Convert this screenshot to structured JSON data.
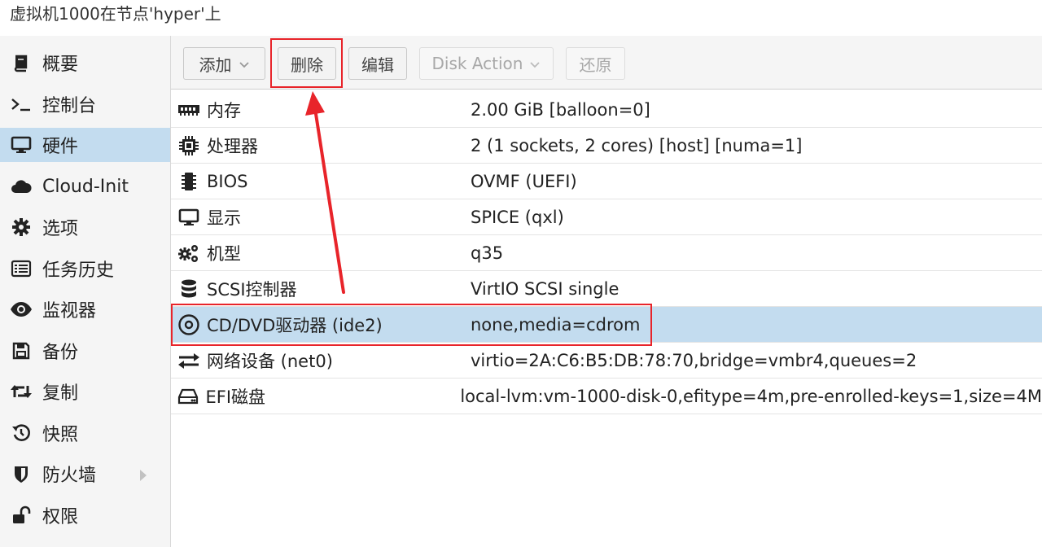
{
  "window": {
    "title": "虚拟机1000在节点'hyper'上"
  },
  "sidebar": {
    "items": [
      {
        "label": "概要",
        "icon": "book-icon"
      },
      {
        "label": "控制台",
        "icon": "terminal-icon"
      },
      {
        "label": "硬件",
        "icon": "desktop-icon",
        "selected": true
      },
      {
        "label": "Cloud-Init",
        "icon": "cloud-icon"
      },
      {
        "label": "选项",
        "icon": "gear-icon"
      },
      {
        "label": "任务历史",
        "icon": "list-icon"
      },
      {
        "label": "监视器",
        "icon": "eye-icon"
      },
      {
        "label": "备份",
        "icon": "floppy-icon"
      },
      {
        "label": "复制",
        "icon": "retweet-icon"
      },
      {
        "label": "快照",
        "icon": "history-icon"
      },
      {
        "label": "防火墙",
        "icon": "shield-icon"
      },
      {
        "label": "权限",
        "icon": "unlock-icon"
      }
    ]
  },
  "toolbar": {
    "add_label": "添加",
    "remove_label": "删除",
    "edit_label": "编辑",
    "disk_action_label": "Disk Action",
    "revert_label": "还原"
  },
  "hardware": {
    "rows": [
      {
        "name": "内存",
        "value": "2.00 GiB [balloon=0]",
        "icon": "memory-icon"
      },
      {
        "name": "处理器",
        "value": "2 (1 sockets, 2 cores) [host] [numa=1]",
        "icon": "cpu-icon"
      },
      {
        "name": "BIOS",
        "value": "OVMF (UEFI)",
        "icon": "microchip-icon"
      },
      {
        "name": "显示",
        "value": "SPICE (qxl)",
        "icon": "desktop-icon"
      },
      {
        "name": "机型",
        "value": "q35",
        "icon": "cogs-icon"
      },
      {
        "name": "SCSI控制器",
        "value": "VirtIO SCSI single",
        "icon": "database-icon"
      },
      {
        "name": "CD/DVD驱动器 (ide2)",
        "value": "none,media=cdrom",
        "icon": "cdrom-icon",
        "selected": true
      },
      {
        "name": "网络设备 (net0)",
        "value": "virtio=2A:C6:B5:DB:78:70,bridge=vmbr4,queues=2",
        "icon": "exchange-icon"
      },
      {
        "name": "EFI磁盘",
        "value": "local-lvm:vm-1000-disk-0,efitype=4m,pre-enrolled-keys=1,size=4M",
        "icon": "hdd-icon"
      }
    ]
  },
  "colors": {
    "selection": "#c3dcef",
    "annotation_red": "#e8242a"
  }
}
